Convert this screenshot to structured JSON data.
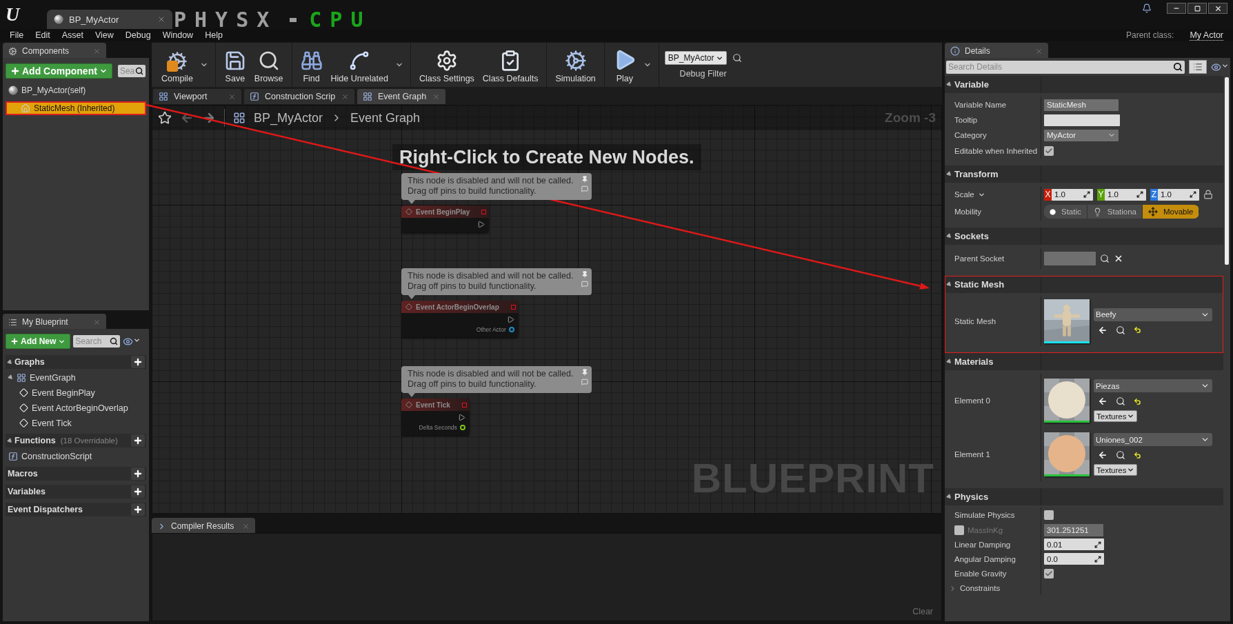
{
  "title_bar": {
    "logo": "U",
    "document_tab": "BP_MyActor",
    "overlay": {
      "left": "PHYSX",
      "right": "CPU"
    }
  },
  "menu": [
    "File",
    "Edit",
    "Asset",
    "View",
    "Debug",
    "Window",
    "Help"
  ],
  "parent_class": {
    "label": "Parent class:",
    "value": "My Actor"
  },
  "components": {
    "title": "Components",
    "add_button": "Add Component",
    "search_placeholder": "Sea",
    "items": [
      {
        "label": "BP_MyActor(self)",
        "selected": false,
        "highlight": false,
        "children": [
          {
            "label": "StaticMesh (Inherited)",
            "selected": true,
            "highlight": true
          }
        ]
      }
    ]
  },
  "my_blueprint": {
    "title": "My Blueprint",
    "add_button": "Add New",
    "search_placeholder": "Search",
    "sections": [
      {
        "title": "Graphs",
        "items": [
          {
            "label": "EventGraph",
            "kind": "graph",
            "children": [
              {
                "label": "Event BeginPlay",
                "kind": "event"
              },
              {
                "label": "Event ActorBeginOverlap",
                "kind": "event"
              },
              {
                "label": "Event Tick",
                "kind": "event"
              }
            ]
          }
        ]
      },
      {
        "title": "Functions",
        "note": "(18 Overridable)",
        "items": [
          {
            "label": "ConstructionScript",
            "kind": "function"
          }
        ]
      },
      {
        "title": "Macros"
      },
      {
        "title": "Variables"
      },
      {
        "title": "Event Dispatchers"
      }
    ]
  },
  "toolbar": {
    "groups": [
      [
        {
          "kind": "compile",
          "label": "Compile",
          "dropdown": true
        }
      ],
      [
        {
          "kind": "save",
          "label": "Save",
          "dropdown": false
        },
        {
          "kind": "browse",
          "label": "Browse",
          "dropdown": false
        }
      ],
      [
        {
          "kind": "find",
          "label": "Find",
          "dropdown": false
        },
        {
          "kind": "hide_unrelated",
          "label": "Hide Unrelated",
          "dropdown": true
        }
      ],
      [
        {
          "kind": "class_settings",
          "label": "Class Settings",
          "dropdown": false
        },
        {
          "kind": "class_defaults",
          "label": "Class Defaults",
          "dropdown": false
        }
      ],
      [
        {
          "kind": "simulation",
          "label": "Simulation",
          "dropdown": false
        }
      ],
      [
        {
          "kind": "play",
          "label": "Play",
          "dropdown": true
        }
      ]
    ],
    "debug_filter": {
      "value": "BP_MyActor",
      "label": "Debug Filter"
    }
  },
  "editor_tabs": [
    {
      "kind": "viewport",
      "label": "Viewport",
      "selected": false
    },
    {
      "kind": "function",
      "label": "Construction Scrip",
      "selected": false
    },
    {
      "kind": "graph",
      "label": "Event Graph",
      "selected": true
    }
  ],
  "graph": {
    "breadcrumb": [
      "BP_MyActor",
      "Event Graph"
    ],
    "zoom": "Zoom -3",
    "hint": "Right-Click to Create New Nodes.",
    "watermark": "BLUEPRINT",
    "nodes": [
      {
        "title": "Event BeginPlay",
        "comment": "This node is disabled and will not be called.\nDrag off pins to build functionality."
      },
      {
        "title": "Event ActorBeginOverlap",
        "comment": "This node is disabled and will not be called.\nDrag off pins to build functionality.",
        "pin": {
          "label": "Other Actor",
          "color": "#1e8ec8"
        }
      },
      {
        "title": "Event Tick",
        "comment": "This node is disabled and will not be called.\nDrag off pins to build functionality.",
        "pin": {
          "label": "Delta Seconds",
          "color": "#7cc21e"
        }
      }
    ]
  },
  "compiler_results": {
    "title": "Compiler Results",
    "clear": "Clear"
  },
  "details": {
    "title": "Details",
    "search_placeholder": "Search Details",
    "sections": [
      {
        "title": "Variable",
        "highlight": false,
        "rows": [
          {
            "kind": "readonly",
            "label": "Variable Name",
            "value": "StaticMesh"
          },
          {
            "kind": "text",
            "label": "Tooltip"
          },
          {
            "kind": "dropdown",
            "label": "Category",
            "value": "MyActor"
          },
          {
            "kind": "checkbox",
            "label": "Editable when Inherited",
            "checked": true
          }
        ]
      },
      {
        "title": "Transform",
        "highlight": false,
        "rows": [
          {
            "kind": "vector",
            "label": "Scale",
            "axes": [
              {
                "axis": "X",
                "value": "1.0",
                "color": "#c81e0a"
              },
              {
                "axis": "Y",
                "value": "1.0",
                "color": "#5aa00a"
              },
              {
                "axis": "Z",
                "value": "1.0",
                "color": "#2a7ae0"
              }
            ]
          },
          {
            "kind": "segmented",
            "label": "Mobility",
            "options": [
              {
                "label": "Static",
                "selected": false
              },
              {
                "label": "Stationa",
                "selected": false
              },
              {
                "label": "Movable",
                "selected": true
              }
            ]
          }
        ]
      },
      {
        "title": "Sockets",
        "highlight": false,
        "rows": [
          {
            "kind": "socket",
            "label": "Parent Socket"
          }
        ]
      },
      {
        "title": "Static Mesh",
        "highlight": true,
        "rows": [
          {
            "kind": "asset",
            "label": "Static Mesh",
            "value": "Beefy"
          }
        ]
      },
      {
        "title": "Materials",
        "highlight": false,
        "rows": [
          {
            "kind": "material",
            "label": "Element 0",
            "value": "Piezas",
            "button": "Textures",
            "color": "#e9dfcd"
          },
          {
            "kind": "material",
            "label": "Element 1",
            "value": "Uniones_002",
            "button": "Textures",
            "color": "#e6b48a"
          }
        ]
      },
      {
        "title": "Physics",
        "highlight": false,
        "rows": [
          {
            "kind": "checkbox",
            "label": "Simulate Physics",
            "checked": false
          },
          {
            "kind": "mass",
            "label": "MassInKg",
            "checked": false,
            "value": "301.251251"
          },
          {
            "kind": "number",
            "label": "Linear Damping",
            "value": "0.01"
          },
          {
            "kind": "number",
            "label": "Angular Damping",
            "value": "0.0"
          },
          {
            "kind": "checkbox",
            "label": "Enable Gravity",
            "checked": true
          },
          {
            "kind": "group",
            "label": "Constraints",
            "expanded": false
          }
        ]
      }
    ]
  }
}
